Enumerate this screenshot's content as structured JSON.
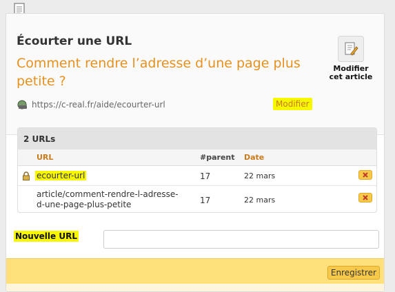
{
  "header": {
    "doc_label": "Écourter une URL",
    "title": "Comment rendre l’adresse d’une page plus petite ?",
    "url": "https://c-real.fr/aide/ecourter-url",
    "modify_link": "Modifier",
    "edit_article_line1": "Modifier",
    "edit_article_line2": "cet article"
  },
  "table": {
    "caption": "2 URLs",
    "columns": [
      "URL",
      "#parent",
      "Date"
    ],
    "rows": [
      {
        "url": "ecourter-url",
        "parent": "17",
        "date": "22 mars",
        "locked": true
      },
      {
        "url": "article/comment-rendre-l-adresse-d-une-page-plus-petite",
        "parent": "17",
        "date": "22 mars",
        "locked": false
      }
    ]
  },
  "form": {
    "new_url_label": "Nouvelle URL",
    "new_url_value": "",
    "save_label": "Enregistrer"
  },
  "colors": {
    "accent": "#e8901e",
    "highlight": "#f7f700",
    "footer": "#ffe07a"
  },
  "icons": [
    "document-icon",
    "globe-icon",
    "edit-article-icon",
    "lock-icon",
    "delete-icon"
  ]
}
